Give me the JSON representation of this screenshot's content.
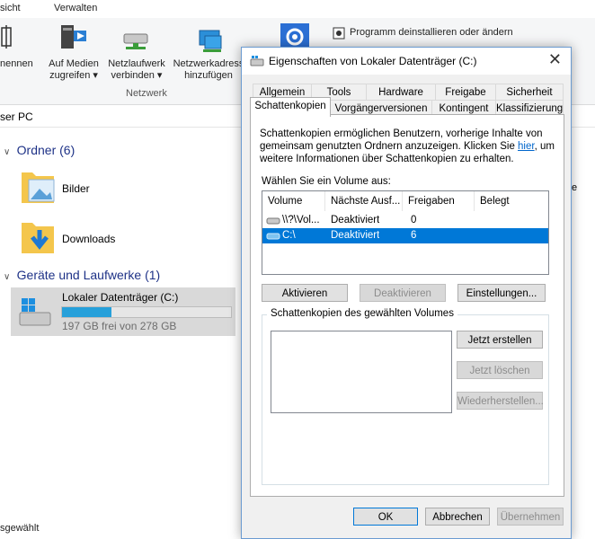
{
  "explorer": {
    "ribbon_tabs": [
      "sicht",
      "Verwalten"
    ],
    "ribbon_buttons": {
      "umbenennen": "nennen",
      "media_line1": "Auf Medien",
      "media_line2": "zugreifen",
      "network_line1": "Netzlaufwerk",
      "network_line2": "verbinden",
      "netaddr_line1": "Netzwerkadress",
      "netaddr_line2": "hinzufügen",
      "uninstall": "Programm deinstallieren oder ändern"
    },
    "group_label": "Netzwerk",
    "address": "ser PC",
    "section_folders": "Ordner (6)",
    "folders": [
      "Bilder",
      "Downloads"
    ],
    "section_devices": "Geräte und Laufwerke (1)",
    "drive": {
      "name": "Lokaler Datenträger (C:)",
      "free_text": "197 GB frei von 278 GB",
      "used_fraction": 0.29
    },
    "side_letter": "e",
    "status": "sgewählt"
  },
  "dialog": {
    "title": "Eigenschaften von Lokaler Datenträger (C:)",
    "tabs_row1": [
      "Allgemein",
      "Tools",
      "Hardware",
      "Freigabe",
      "Sicherheit"
    ],
    "tabs_row2": [
      "Schattenkopien",
      "Vorgängerversionen",
      "Kontingent",
      "Klassifizierung"
    ],
    "active_tab": "Schattenkopien",
    "desc_line1": "Schattenkopien ermöglichen Benutzern, vorherige Inhalte von",
    "desc_line2": "gemeinsam genutzten Ordnern anzuzeigen. Klicken Sie ",
    "desc_link": "hier",
    "desc_line2_end": ", um",
    "desc_line3": "weitere Informationen über Schattenkopien zu erhalten.",
    "volume_label": "Wählen Sie ein Volume aus:",
    "columns": [
      "Volume",
      "Nächste Ausf...",
      "Freigaben",
      "Belegt"
    ],
    "rows": [
      {
        "volume": "\\\\?\\Vol...",
        "next": "Deaktiviert",
        "shares": "0",
        "used": ""
      },
      {
        "volume": "C:\\",
        "next": "Deaktiviert",
        "shares": "6",
        "used": ""
      }
    ],
    "btn_enable": "Aktivieren",
    "btn_disable": "Deaktivieren",
    "btn_settings": "Einstellungen...",
    "group_title": "Schattenkopien des gewählten Volumes",
    "btn_create": "Jetzt erstellen",
    "btn_delete": "Jetzt löschen",
    "btn_restore": "Wiederherstellen...",
    "btn_ok": "OK",
    "btn_cancel": "Abbrechen",
    "btn_apply": "Übernehmen"
  }
}
